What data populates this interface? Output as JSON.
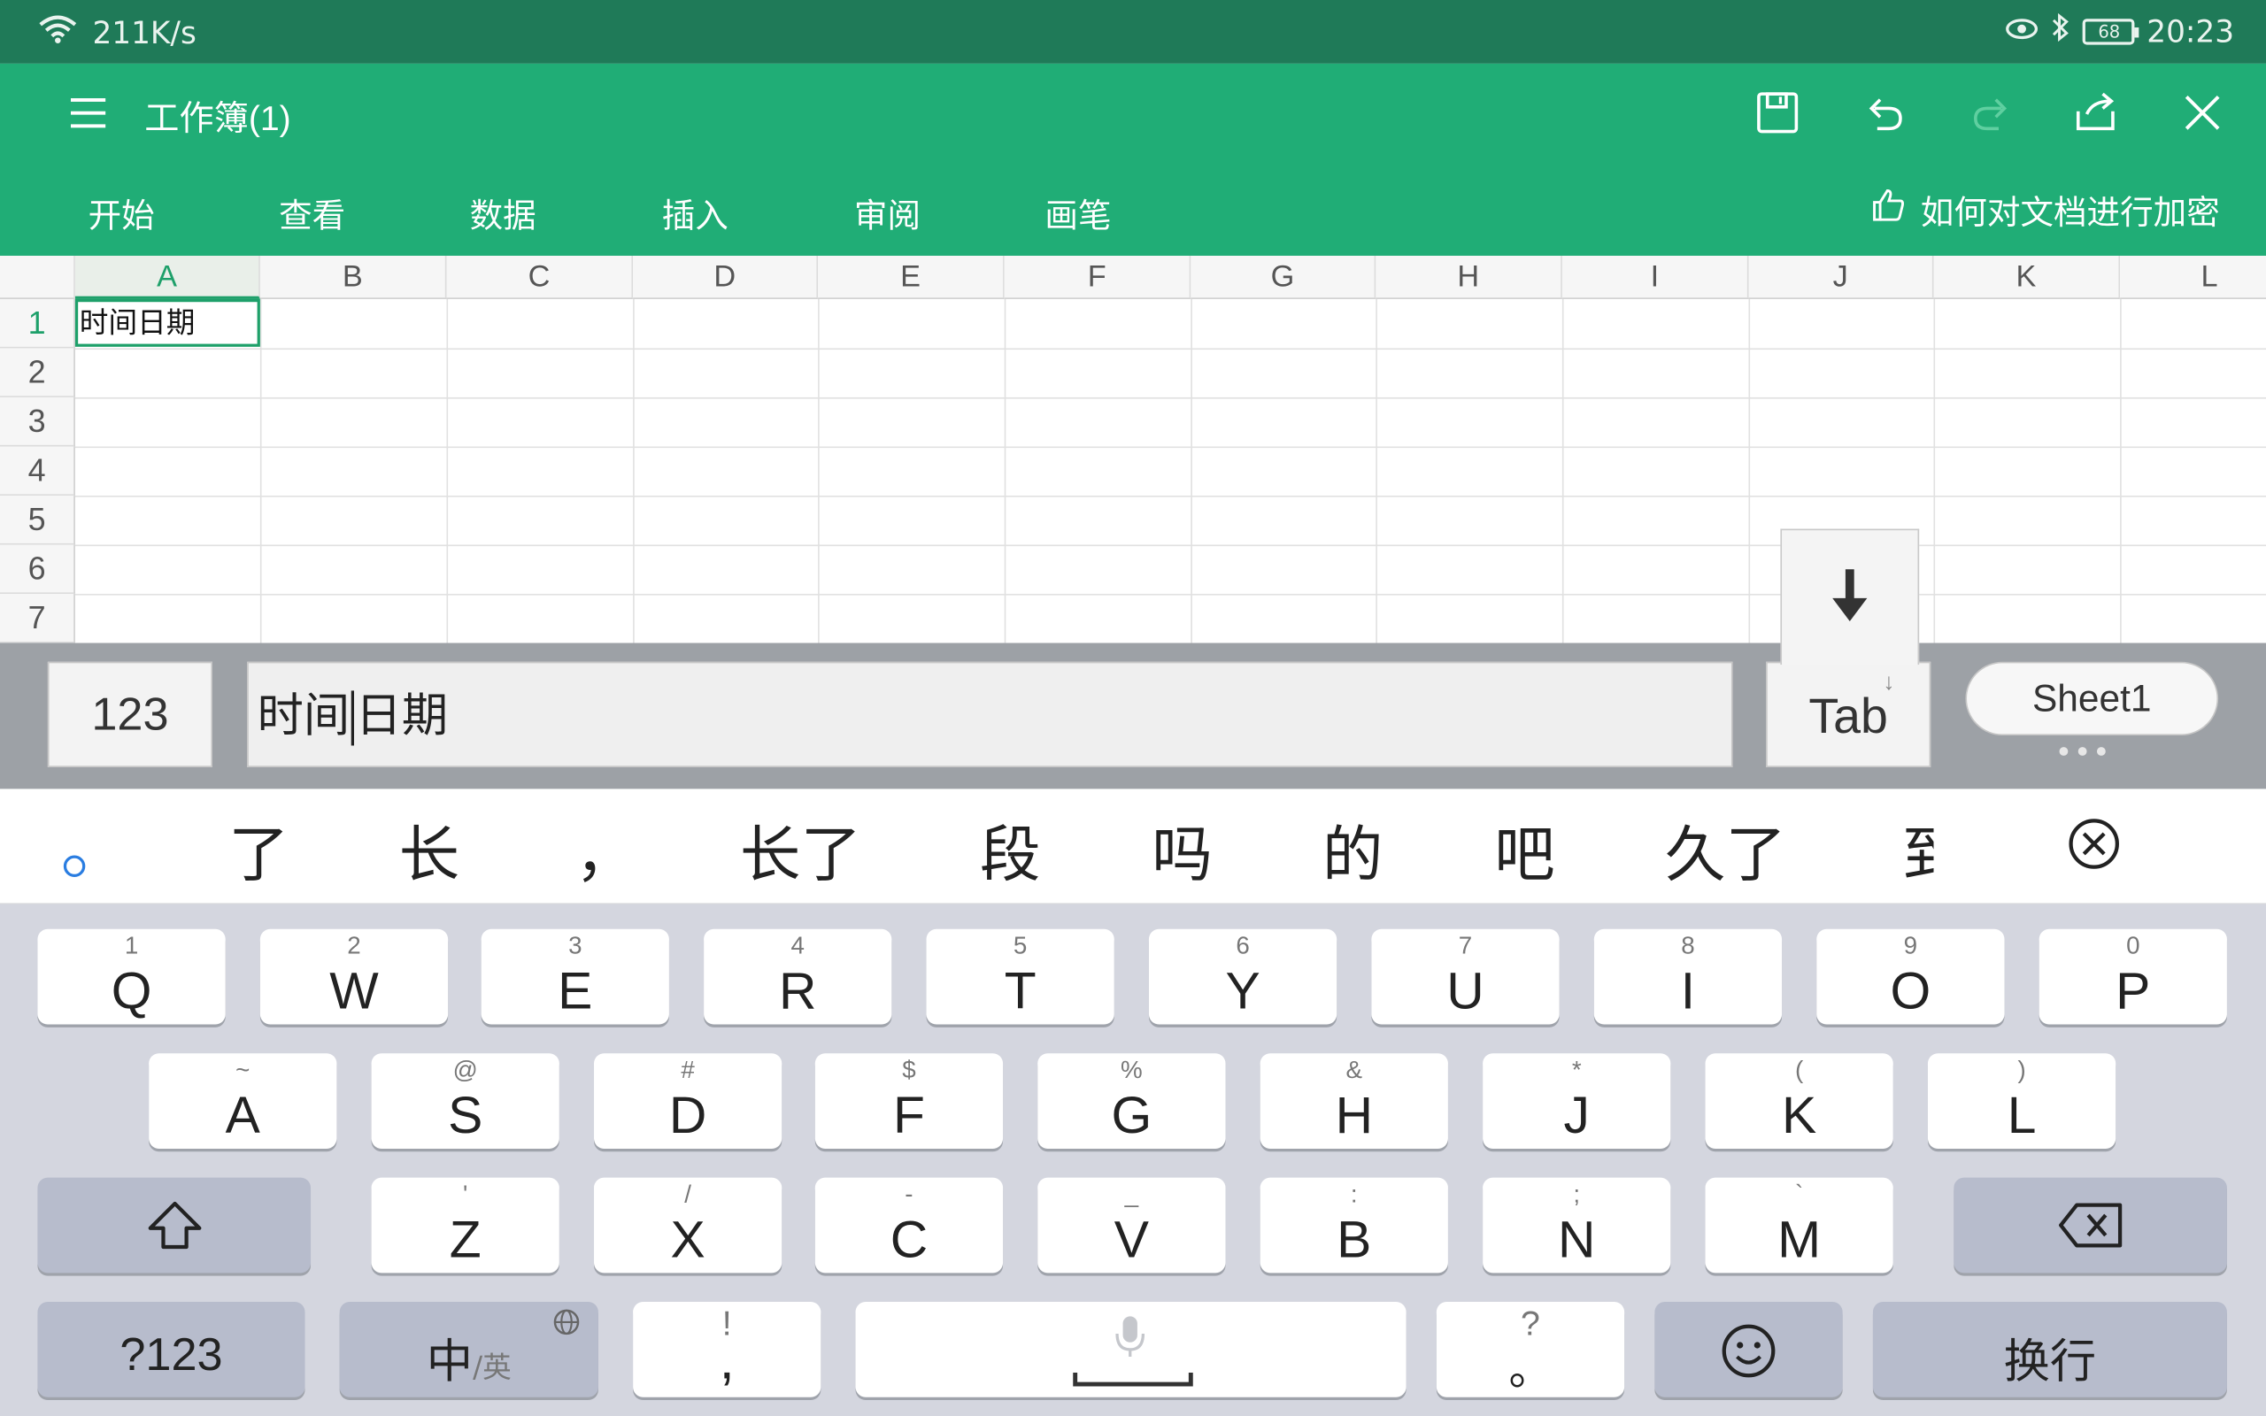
{
  "status": {
    "network_speed": "211K/s",
    "battery": "68",
    "time": "20:23"
  },
  "app": {
    "title": "工作簿(1)"
  },
  "menu": [
    "开始",
    "查看",
    "数据",
    "插入",
    "审阅",
    "画笔"
  ],
  "tip": "如何对文档进行加密",
  "columns": [
    "A",
    "B",
    "C",
    "D",
    "E",
    "F",
    "G",
    "H",
    "I",
    "J",
    "K",
    "L"
  ],
  "rows": [
    "1",
    "2",
    "3",
    "4",
    "5",
    "6",
    "7"
  ],
  "cell_a1": "时间日期",
  "input_bar": {
    "num_key": "123",
    "formula_before": "时间",
    "formula_after": "日期",
    "tab_key": "Tab",
    "sheet_tab": "Sheet1"
  },
  "candidates": [
    "了",
    "长",
    "，",
    "长了",
    "段",
    "吗",
    "的",
    "吧",
    "久了",
    "到"
  ],
  "keyboard": {
    "row1": [
      {
        "hint": "1",
        "main": "Q"
      },
      {
        "hint": "2",
        "main": "W"
      },
      {
        "hint": "3",
        "main": "E"
      },
      {
        "hint": "4",
        "main": "R"
      },
      {
        "hint": "5",
        "main": "T"
      },
      {
        "hint": "6",
        "main": "Y"
      },
      {
        "hint": "7",
        "main": "U"
      },
      {
        "hint": "8",
        "main": "I"
      },
      {
        "hint": "9",
        "main": "O"
      },
      {
        "hint": "0",
        "main": "P"
      }
    ],
    "row2": [
      {
        "hint": "~",
        "main": "A"
      },
      {
        "hint": "@",
        "main": "S"
      },
      {
        "hint": "#",
        "main": "D"
      },
      {
        "hint": "$",
        "main": "F"
      },
      {
        "hint": "%",
        "main": "G"
      },
      {
        "hint": "&",
        "main": "H"
      },
      {
        "hint": "*",
        "main": "J"
      },
      {
        "hint": "(",
        "main": "K"
      },
      {
        "hint": ")",
        "main": "L"
      }
    ],
    "row3": [
      {
        "hint": "'",
        "main": "Z"
      },
      {
        "hint": "/",
        "main": "X"
      },
      {
        "hint": "-",
        "main": "C"
      },
      {
        "hint": "_",
        "main": "V"
      },
      {
        "hint": ":",
        "main": "B"
      },
      {
        "hint": ";",
        "main": "N"
      },
      {
        "hint": "`",
        "main": "M"
      }
    ],
    "symbols_key": "?123",
    "lang_key_main": "中",
    "lang_key_sub": "/英",
    "comma_hint": "!",
    "comma_main": ",",
    "period_hint": "?",
    "period_main": "。",
    "enter_key": "换行"
  }
}
